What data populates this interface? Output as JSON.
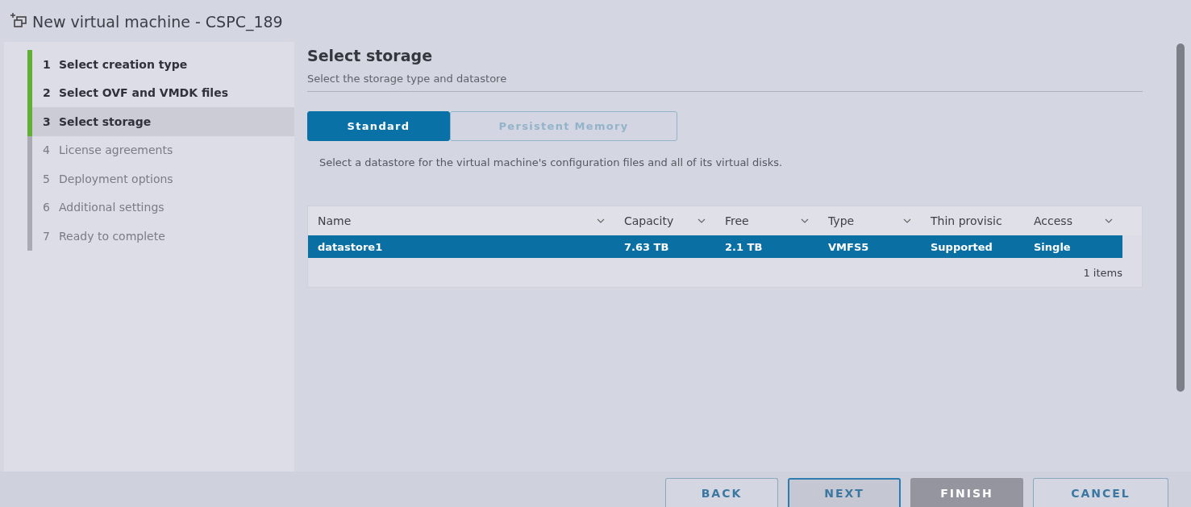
{
  "window": {
    "title": "New virtual machine - CSPC_189"
  },
  "steps": [
    {
      "number": "1",
      "label": "Select creation type",
      "completed": true,
      "selected": false
    },
    {
      "number": "2",
      "label": "Select OVF and VMDK files",
      "completed": true,
      "selected": false
    },
    {
      "number": "3",
      "label": "Select storage",
      "completed": false,
      "selected": true
    },
    {
      "number": "4",
      "label": "License agreements",
      "completed": false,
      "selected": false
    },
    {
      "number": "5",
      "label": "Deployment options",
      "completed": false,
      "selected": false
    },
    {
      "number": "6",
      "label": "Additional settings",
      "completed": false,
      "selected": false
    },
    {
      "number": "7",
      "label": "Ready to complete",
      "completed": false,
      "selected": false
    }
  ],
  "page": {
    "title": "Select storage",
    "subtitle": "Select the storage type and datastore"
  },
  "tabs": [
    {
      "label": "Standard",
      "selected": true
    },
    {
      "label": "Persistent Memory",
      "selected": false
    }
  ],
  "instruction": "Select a datastore for the virtual machine's configuration files and all of its virtual disks.",
  "table": {
    "columns": [
      {
        "label": "Name",
        "sortable": true
      },
      {
        "label": "Capacity",
        "sortable": true
      },
      {
        "label": "Free",
        "sortable": true
      },
      {
        "label": "Type",
        "sortable": true
      },
      {
        "label": "Thin provisic",
        "sortable": false
      },
      {
        "label": "Access",
        "sortable": true
      }
    ],
    "rows": [
      {
        "cells": [
          "datastore1",
          "7.63 TB",
          "2.1 TB",
          "VMFS5",
          "Supported",
          "Single"
        ],
        "selected": true
      }
    ],
    "footer": "1 items"
  },
  "buttons": [
    {
      "label": "BACK",
      "disabled": false,
      "focused": false
    },
    {
      "label": "NEXT",
      "disabled": false,
      "focused": true
    },
    {
      "label": "FINISH",
      "disabled": true,
      "focused": false
    },
    {
      "label": "CANCEL",
      "disabled": false,
      "focused": false
    }
  ]
}
